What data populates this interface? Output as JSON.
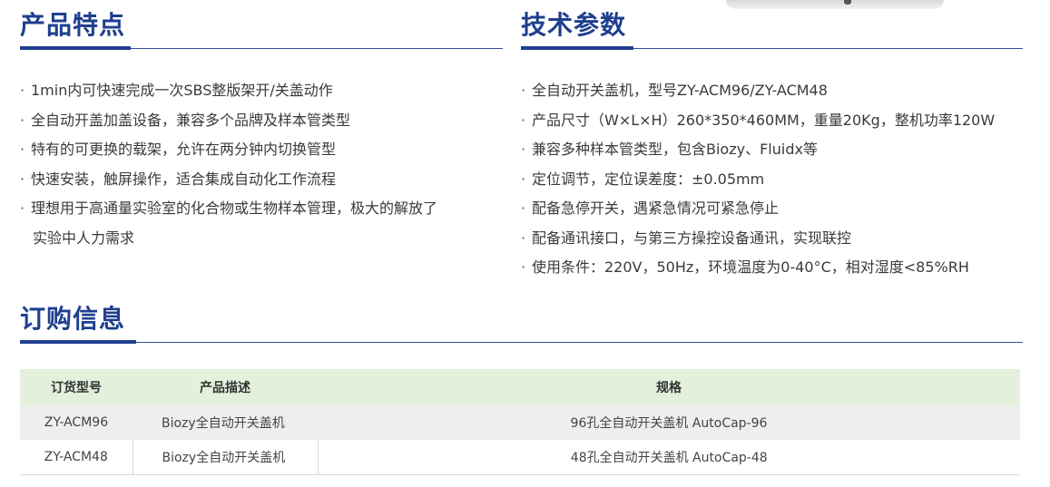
{
  "features": {
    "title": "产品特点",
    "items": [
      "1min内可快速完成一次SBS整版架开/关盖动作",
      "全自动开盖加盖设备，兼容多个品牌及样本管类型",
      "特有的可更换的载架，允许在两分钟内切换管型",
      "快速安装，触屏操作，适合集成自动化工作流程",
      "理想用于高通量实验室的化合物或生物样本管理，极大的解放了"
    ],
    "items_continuation": "实验中人力需求"
  },
  "specs": {
    "title": "技术参数",
    "items": [
      "全自动开关盖机，型号ZY-ACM96/ZY-ACM48",
      "产品尺寸（W×L×H）260*350*460MM，重量20Kg，整机功率120W",
      "兼容多种样本管类型，包含Biozy、Fluidx等",
      "定位调节，定位误差度：±0.05mm",
      "配备急停开关，遇紧急情况可紧急停止",
      "配备通讯接口，与第三方操控设备通讯，实现联控",
      "使用条件：220V，50Hz，环境温度为0-40°C，相对湿度<85%RH"
    ]
  },
  "ordering": {
    "title": "订购信息",
    "headers": [
      "订货型号",
      "产品描述",
      "规格"
    ],
    "rows": [
      [
        "ZY-ACM96",
        "Biozy全自动开关盖机",
        "96孔全自动开关盖机 AutoCap-96"
      ],
      [
        "ZY-ACM48",
        "Biozy全自动开关盖机",
        "48孔全自动开关盖机 AutoCap-48"
      ]
    ]
  },
  "colors": {
    "title": "#1f3f8f",
    "header_bg": "#e2f0dc",
    "row_alt_bg": "#eeeeee"
  }
}
